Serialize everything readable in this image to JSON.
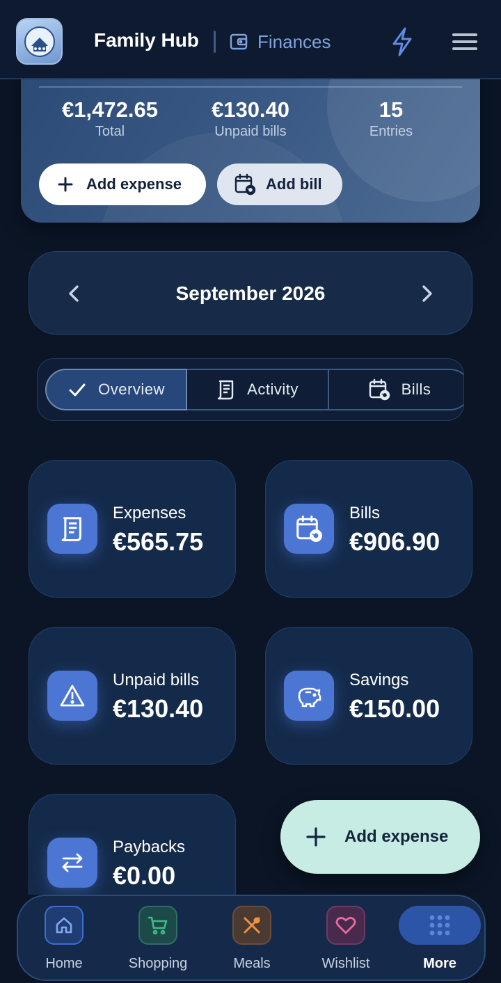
{
  "header": {
    "title": "Family Hub",
    "section": "Finances"
  },
  "summary": {
    "total_value": "€1,472.65",
    "total_label": "Total",
    "unpaid_value": "€130.40",
    "unpaid_label": "Unpaid bills",
    "entries_value": "15",
    "entries_label": "Entries",
    "add_expense_label": "Add expense",
    "add_bill_label": "Add bill"
  },
  "month": {
    "label": "September 2026"
  },
  "tabs": [
    {
      "label": "Overview",
      "active": true
    },
    {
      "label": "Activity",
      "active": false
    },
    {
      "label": "Bills",
      "active": false
    }
  ],
  "tiles": [
    {
      "label": "Expenses",
      "value": "€565.75",
      "icon": "receipt-icon"
    },
    {
      "label": "Bills",
      "value": "€906.90",
      "icon": "calendar-refresh-icon"
    },
    {
      "label": "Unpaid bills",
      "value": "€130.40",
      "icon": "warning-icon"
    },
    {
      "label": "Savings",
      "value": "€150.00",
      "icon": "piggy-bank-icon"
    },
    {
      "label": "Paybacks",
      "value": "€0.00",
      "icon": "swap-arrows-icon"
    }
  ],
  "fab": {
    "label": "Add expense"
  },
  "bottom_nav": [
    {
      "label": "Home",
      "icon": "home-icon",
      "color": "#3a6fcf"
    },
    {
      "label": "Shopping",
      "icon": "cart-icon",
      "color": "#2fa37a"
    },
    {
      "label": "Meals",
      "icon": "utensils-icon",
      "color": "#e0843a"
    },
    {
      "label": "Wishlist",
      "icon": "heart-icon",
      "color": "#d9578c"
    },
    {
      "label": "More",
      "icon": "grid-icon",
      "active": true
    }
  ],
  "colors": {
    "background": "#0b1526",
    "accent": "#4b76d4",
    "fab": "#c7ece4"
  }
}
